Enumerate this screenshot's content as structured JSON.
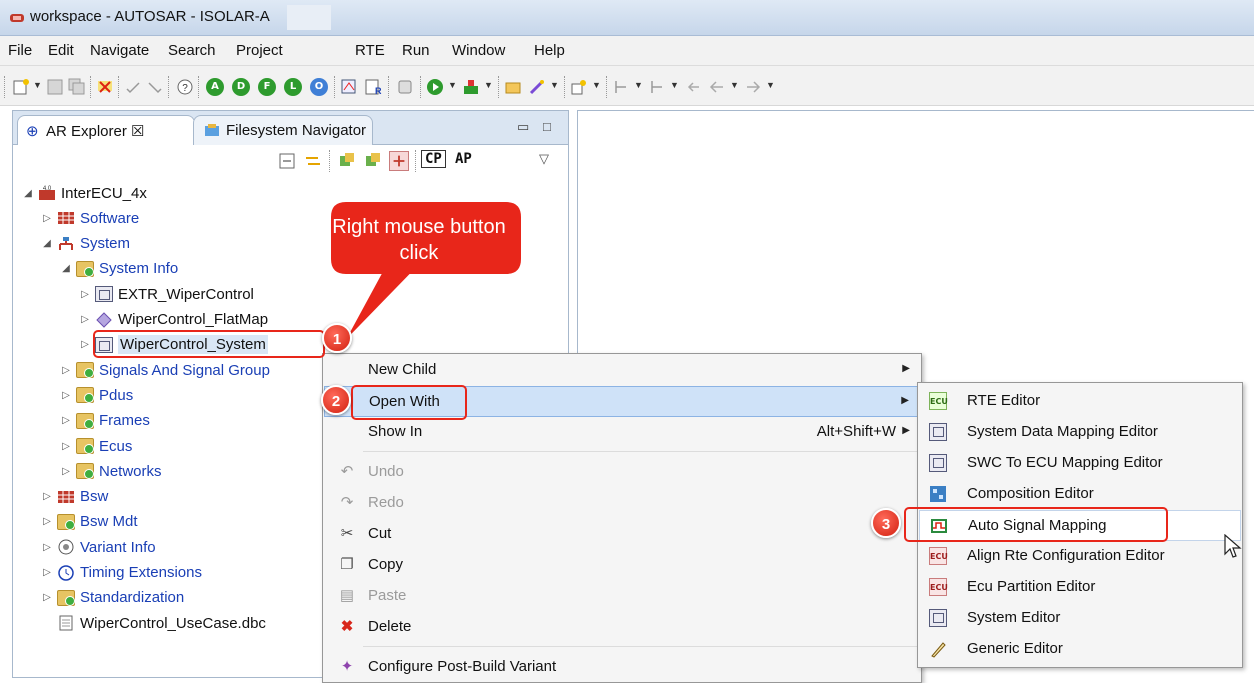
{
  "window": {
    "title": "workspace - AUTOSAR - ISOLAR-A"
  },
  "menubar": {
    "items": [
      "File",
      "Edit",
      "Navigate",
      "Search",
      "Project",
      "RTE",
      "Run",
      "Window",
      "Help"
    ]
  },
  "toolbar": {
    "circle_buttons": [
      {
        "letter": "A",
        "color": "#2e9b2e"
      },
      {
        "letter": "D",
        "color": "#2e9b2e"
      },
      {
        "letter": "F",
        "color": "#2e9b2e"
      },
      {
        "letter": "L",
        "color": "#2e9b2e"
      },
      {
        "letter": "O",
        "color": "#3f7fd6"
      }
    ]
  },
  "explorer": {
    "tabs": [
      {
        "label": "AR Explorer ☒",
        "active": true
      },
      {
        "label": "Filesystem Navigator",
        "active": false
      }
    ],
    "window_controls": {
      "minimize": "▭",
      "maximize": "□"
    },
    "toolbar": {
      "cp": "CP",
      "ap": "AP",
      "menu": "▽"
    },
    "tree": [
      {
        "label": "InterECU_4x",
        "depth": 0,
        "twisty": "◢",
        "icon": "project-icon",
        "blue": false
      },
      {
        "label": "Software",
        "depth": 1,
        "twisty": "▷",
        "icon": "software-icon",
        "blue": true
      },
      {
        "label": "System",
        "depth": 1,
        "twisty": "◢",
        "icon": "system-icon",
        "blue": true
      },
      {
        "label": "System Info",
        "depth": 2,
        "twisty": "◢",
        "icon": "folder-icon",
        "blue": true
      },
      {
        "label": "EXTR_WiperControl",
        "depth": 3,
        "twisty": "▷",
        "icon": "box-icon",
        "blue": false
      },
      {
        "label": "WiperControl_FlatMap",
        "depth": 3,
        "twisty": "▷",
        "icon": "diamond-icon",
        "blue": false
      },
      {
        "label": "WiperControl_System",
        "depth": 3,
        "twisty": "▷",
        "icon": "box-icon",
        "blue": false,
        "selected": true
      },
      {
        "label": "Signals And Signal Group",
        "depth": 2,
        "twisty": "▷",
        "icon": "folder-icon",
        "blue": true
      },
      {
        "label": "Pdus",
        "depth": 2,
        "twisty": "▷",
        "icon": "folder-icon",
        "blue": true
      },
      {
        "label": "Frames",
        "depth": 2,
        "twisty": "▷",
        "icon": "folder-icon",
        "blue": true
      },
      {
        "label": "Ecus",
        "depth": 2,
        "twisty": "▷",
        "icon": "folder-icon",
        "blue": true
      },
      {
        "label": "Networks",
        "depth": 2,
        "twisty": "▷",
        "icon": "folder-icon",
        "blue": true
      },
      {
        "label": "Bsw",
        "depth": 1,
        "twisty": "▷",
        "icon": "bsw-icon",
        "blue": true
      },
      {
        "label": "Bsw Mdt",
        "depth": 1,
        "twisty": "▷",
        "icon": "folder-icon",
        "blue": true
      },
      {
        "label": "Variant Info",
        "depth": 1,
        "twisty": "▷",
        "icon": "variant-icon",
        "blue": true
      },
      {
        "label": "Timing Extensions",
        "depth": 1,
        "twisty": "▷",
        "icon": "clock-icon",
        "blue": true
      },
      {
        "label": "Standardization",
        "depth": 1,
        "twisty": "▷",
        "icon": "folder-icon",
        "blue": true
      },
      {
        "label": "WiperControl_UseCase.dbc",
        "depth": 1,
        "twisty": "",
        "icon": "file-icon",
        "blue": false
      }
    ]
  },
  "context_menu": {
    "items": [
      {
        "label": "New Child",
        "accel": "",
        "submenu": true,
        "icon": "",
        "disabled": false
      },
      {
        "label": "Open With",
        "accel": "",
        "submenu": true,
        "icon": "",
        "disabled": false,
        "hover": true
      },
      {
        "label": "Show In",
        "accel": "Alt+Shift+W",
        "submenu": true,
        "icon": "",
        "disabled": false
      },
      {
        "label": "Undo",
        "accel": "",
        "submenu": false,
        "icon": "undo-icon",
        "disabled": true
      },
      {
        "label": "Redo",
        "accel": "",
        "submenu": false,
        "icon": "redo-icon",
        "disabled": true
      },
      {
        "label": "Cut",
        "accel": "",
        "submenu": false,
        "icon": "scissors-icon",
        "disabled": false
      },
      {
        "label": "Copy",
        "accel": "",
        "submenu": false,
        "icon": "copy-icon",
        "disabled": false
      },
      {
        "label": "Paste",
        "accel": "",
        "submenu": false,
        "icon": "paste-icon",
        "disabled": true
      },
      {
        "label": "Delete",
        "accel": "",
        "submenu": false,
        "icon": "delete-icon",
        "disabled": false
      },
      {
        "label": "Configure Post-Build Variant",
        "accel": "",
        "submenu": false,
        "icon": "configure-icon",
        "disabled": false
      }
    ]
  },
  "open_with_submenu": {
    "items": [
      {
        "label": "RTE Editor",
        "icon": "ecu-icon"
      },
      {
        "label": "System Data Mapping Editor",
        "icon": "box-icon"
      },
      {
        "label": "SWC To ECU Mapping Editor",
        "icon": "box-icon"
      },
      {
        "label": "Composition Editor",
        "icon": "composition-icon"
      },
      {
        "label": "Auto Signal Mapping",
        "icon": "signal-icon",
        "hover": true
      },
      {
        "label": "Align Rte Configuration Editor",
        "icon": "ecu-red-icon"
      },
      {
        "label": "Ecu Partition Editor",
        "icon": "ecu-red-icon"
      },
      {
        "label": "System Editor",
        "icon": "box-icon"
      },
      {
        "label": "Generic Editor",
        "icon": "pencil-icon"
      }
    ]
  },
  "annotations": {
    "callout": "Right mouse button click",
    "badges": [
      "1",
      "2",
      "3"
    ]
  },
  "colors": {
    "annotation_red": "#e8261a",
    "tree_link_blue": "#1a3fb5",
    "menu_hover": "#cfe2f8"
  }
}
